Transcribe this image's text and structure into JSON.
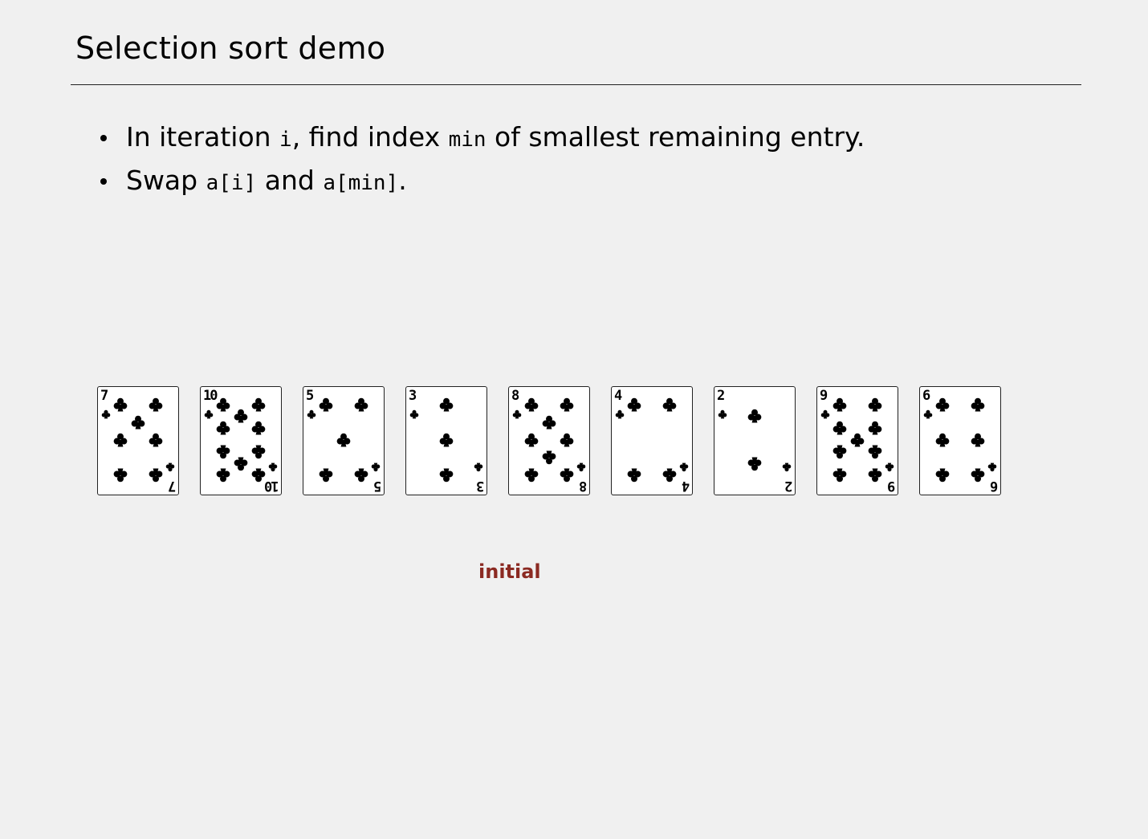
{
  "slide": {
    "title": "Selection sort demo",
    "bullets": [
      {
        "p1": "In iteration ",
        "c1": "i",
        "p2": ", find index ",
        "c2": "min",
        "p3": " of smallest remaining entry."
      },
      {
        "p1": "Swap ",
        "c1": "a[i]",
        "p2": " and ",
        "c2": "a[min]",
        "p3": "."
      }
    ],
    "status": "initial",
    "status_color": "#8b2a22"
  },
  "cards": [
    {
      "rank": "7",
      "suit": "club-icon"
    },
    {
      "rank": "10",
      "suit": "club-icon"
    },
    {
      "rank": "5",
      "suit": "club-icon"
    },
    {
      "rank": "3",
      "suit": "club-icon"
    },
    {
      "rank": "8",
      "suit": "club-icon"
    },
    {
      "rank": "4",
      "suit": "club-icon"
    },
    {
      "rank": "2",
      "suit": "club-icon"
    },
    {
      "rank": "9",
      "suit": "club-icon"
    },
    {
      "rank": "6",
      "suit": "club-icon"
    }
  ]
}
